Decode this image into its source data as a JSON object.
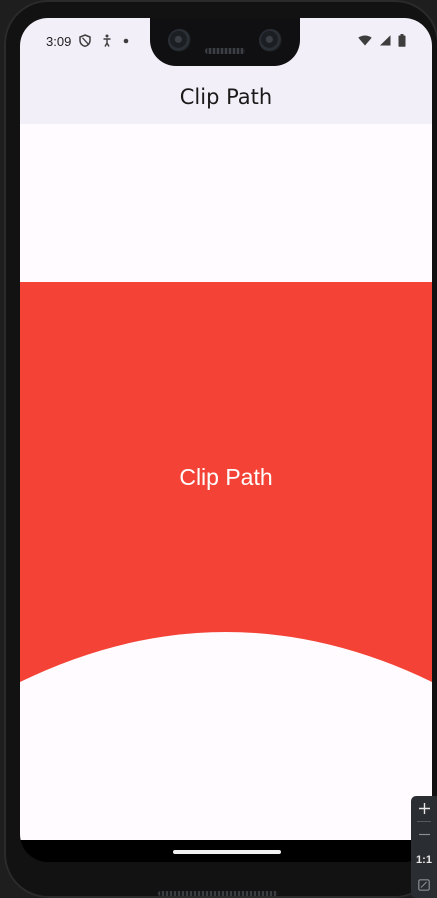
{
  "status_bar": {
    "time": "3:09",
    "left_icons": [
      "shield-icon",
      "accessibility-icon",
      "dot-icon"
    ],
    "right_icons": [
      "wifi-icon",
      "signal-icon",
      "battery-icon"
    ]
  },
  "app_bar": {
    "title": "Clip Path"
  },
  "content": {
    "clip_label": "Clip Path",
    "clip_color": "#f44336",
    "background_color": "#fffbfe"
  },
  "emulator_controls": {
    "zoom_in_icon": "plus-icon",
    "zoom_out_icon": "minus-icon",
    "actual_size_label": "1:1",
    "fit_icon": "fit-screen-icon"
  }
}
